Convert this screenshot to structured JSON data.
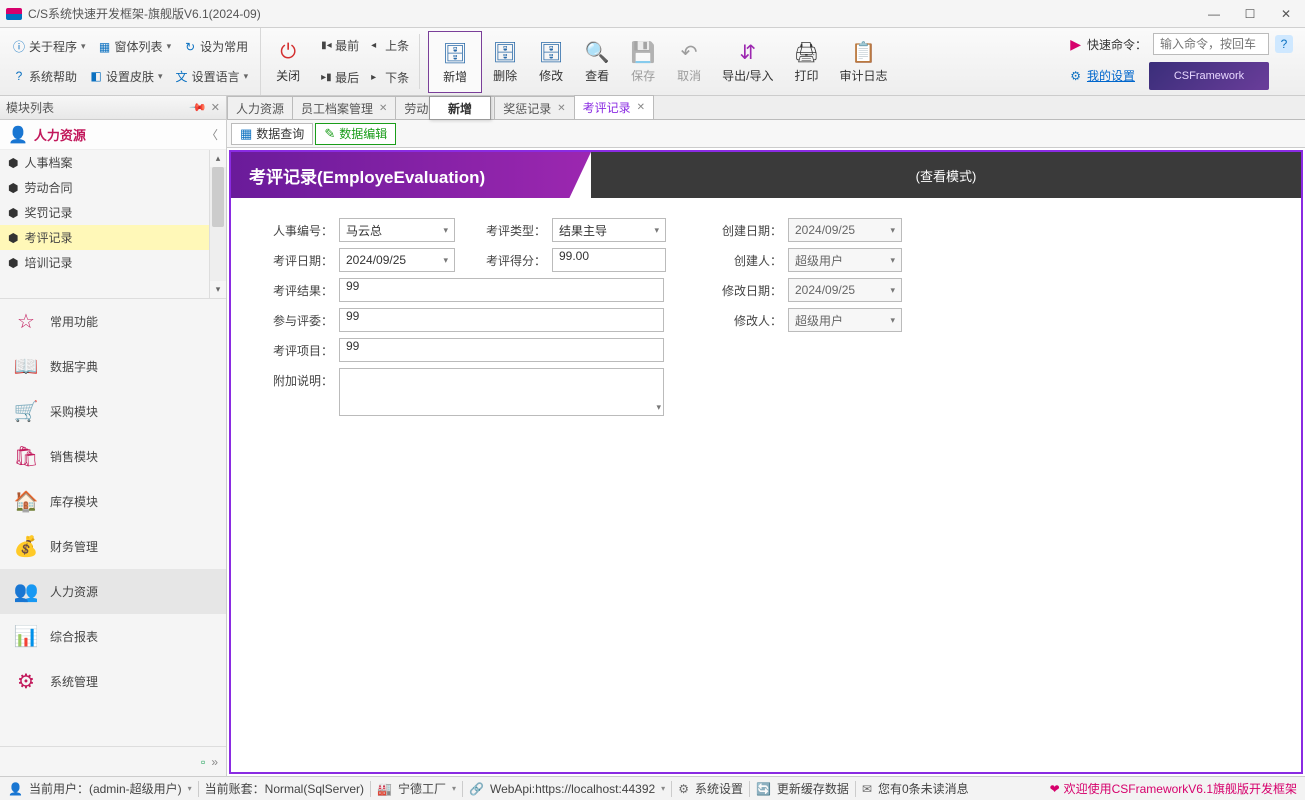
{
  "window": {
    "title": "C/S系统快速开发框架-旗舰版V6.1(2024-09)"
  },
  "menu_left": {
    "about": "关于程序",
    "forms": "窗体列表",
    "fav": "设为常用",
    "help": "系统帮助",
    "skin": "设置皮肤",
    "lang": "设置语言"
  },
  "nav": {
    "first": "最前",
    "prev": "上条",
    "last": "最后",
    "next": "下条"
  },
  "toolbar": {
    "close": "关闭",
    "add": "新增",
    "delete": "删除",
    "edit": "修改",
    "view": "查看",
    "save": "保存",
    "cancel": "取消",
    "io": "导出/导入",
    "print": "打印",
    "audit": "审计日志"
  },
  "popup_tab": "新增",
  "right": {
    "quick_label": "快速命令：",
    "quick_placeholder": "输入命令，按回车",
    "my_settings": "我的设置",
    "csf": "CSFramework"
  },
  "sidebar": {
    "header": "模块列表",
    "tree_caption": "人力资源",
    "tree": [
      "人事档案",
      "劳动合同",
      "奖罚记录",
      "考评记录",
      "培训记录"
    ],
    "tree_selected": 3,
    "modules": [
      "常用功能",
      "数据字典",
      "采购模块",
      "销售模块",
      "库存模块",
      "财务管理",
      "人力资源",
      "综合报表",
      "系统管理"
    ],
    "module_active": 6
  },
  "tabs": {
    "items": [
      "人力资源",
      "员工档案管理",
      "劳动合",
      "",
      "奖惩记录",
      "考评记录"
    ],
    "active": 5
  },
  "subtabs": {
    "query": "数据查询",
    "edit": "数据编辑"
  },
  "hero": {
    "title": "考评记录(EmployeEvaluation)",
    "mode": "(查看模式)"
  },
  "form": {
    "hr_no_lbl": "人事编号：",
    "hr_no": "马云总",
    "eval_date_lbl": "考评日期：",
    "eval_date": "2024/09/25",
    "eval_result_lbl": "考评结果：",
    "eval_result": "99",
    "judges_lbl": "参与评委：",
    "judges": "99",
    "item_lbl": "考评项目：",
    "item": "99",
    "remark_lbl": "附加说明：",
    "remark": "",
    "eval_type_lbl": "考评类型：",
    "eval_type": "结果主导",
    "score_lbl": "考评得分：",
    "score": "99.00",
    "created_date_lbl": "创建日期：",
    "created_date": "2024/09/25",
    "creator_lbl": "创建人：",
    "creator": "超级用户",
    "mod_date_lbl": "修改日期：",
    "mod_date": "2024/09/25",
    "modifier_lbl": "修改人：",
    "modifier": "超级用户"
  },
  "status": {
    "user": "当前用户：(admin-超级用户)",
    "acct": "当前账套：Normal(SqlServer)",
    "factory": "宁德工厂",
    "webapi": "WebApi:https://localhost:44392",
    "sys": "系统设置",
    "cache": "更新缓存数据",
    "msg": "您有0条未读消息",
    "welcome": "欢迎使用CSFrameworkV6.1旗舰版开发框架"
  }
}
